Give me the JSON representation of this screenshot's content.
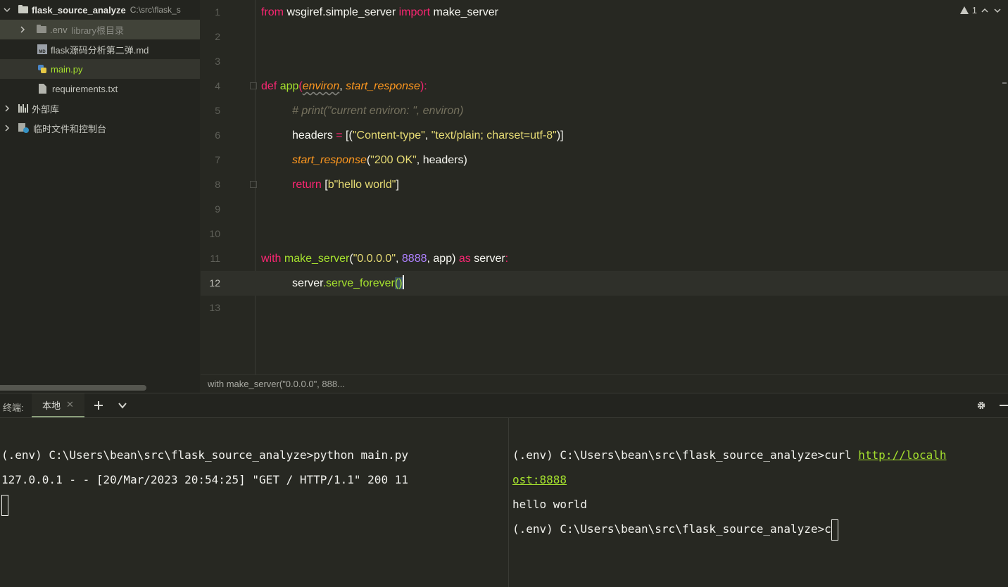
{
  "project": {
    "root": {
      "name": "flask_source_analyze",
      "path": "C:\\src\\flask_s"
    },
    "items": [
      {
        "name": ".env",
        "note": "library根目录"
      },
      {
        "name": "flask源码分析第二弹.md",
        "icon_text": "MD"
      },
      {
        "name": "main.py"
      },
      {
        "name": "requirements.txt"
      },
      {
        "name": "外部库"
      },
      {
        "name": "临时文件和控制台"
      }
    ]
  },
  "editor": {
    "line_numbers": [
      "1",
      "2",
      "3",
      "4",
      "5",
      "6",
      "7",
      "8",
      "9",
      "10",
      "11",
      "12",
      "13"
    ],
    "current_line": 12,
    "code": {
      "l1": {
        "t1": "from",
        "t2": " wsgiref.simple_server ",
        "t3": "import",
        "t4": " make_server"
      },
      "l4": {
        "t1": "def",
        "t2": " ",
        "t3": "app",
        "t4": "(",
        "t5": "environ",
        "t6": ", ",
        "t7": "start_response",
        "t8": "):"
      },
      "l5": {
        "t1": "# print(\"current environ: \", environ)"
      },
      "l6": {
        "t1": "headers ",
        "t2": "=",
        "t3": " [(",
        "t4": "\"Content-type\"",
        "t5": ", ",
        "t6": "\"text/plain; charset=utf-8\"",
        "t7": ")]"
      },
      "l7": {
        "t1": "start_response",
        "t2": "(",
        "t3": "\"200 OK\"",
        "t4": ", headers)"
      },
      "l8": {
        "t1": "return",
        "t2": " [",
        "t3": "b\"hello world\"",
        "t4": "]"
      },
      "l11": {
        "t1": "with",
        "t2": " ",
        "t3": "make_server",
        "t4": "(",
        "t5": "\"0.0.0.0\"",
        "t6": ", ",
        "t7": "8888",
        "t8": ", app) ",
        "t9": "as",
        "t10": " server",
        "t11": ":"
      },
      "l12": {
        "t1": "server",
        "t2": ".",
        "t3": "serve_forever",
        "t4": "()"
      }
    },
    "inspection": {
      "count": "1"
    },
    "breadcrumb": "with make_server(\"0.0.0.0\", 888..."
  },
  "terminal": {
    "title": "终端:",
    "tab": "本地",
    "left_lines": [
      "(.env) C:\\Users\\bean\\src\\flask_source_analyze>python main.py",
      "127.0.0.1 - - [20/Mar/2023 20:54:25] \"GET / HTTP/1.1\" 200 11"
    ],
    "right": {
      "prompt1": "(.env) C:\\Users\\bean\\src\\flask_source_analyze>curl ",
      "link1": "http://localh",
      "link2": "ost:8888",
      "output": "hello world",
      "prompt2": "(.env) C:\\Users\\bean\\src\\flask_source_analyze>c"
    }
  },
  "colors": {
    "keyword": "#f92672",
    "function": "#a6e22e",
    "string": "#e6db74",
    "number": "#ae81ff",
    "param": "#fd971f",
    "comment": "#75715e"
  },
  "icons": [
    "folder-icon",
    "chevron-right-icon",
    "chevron-down-icon",
    "markdown-file-icon",
    "python-file-icon",
    "text-file-icon",
    "library-icon",
    "scratch-icon",
    "warning-icon",
    "chevron-up-icon",
    "plus-icon",
    "gear-icon",
    "minus-icon",
    "close-icon"
  ]
}
